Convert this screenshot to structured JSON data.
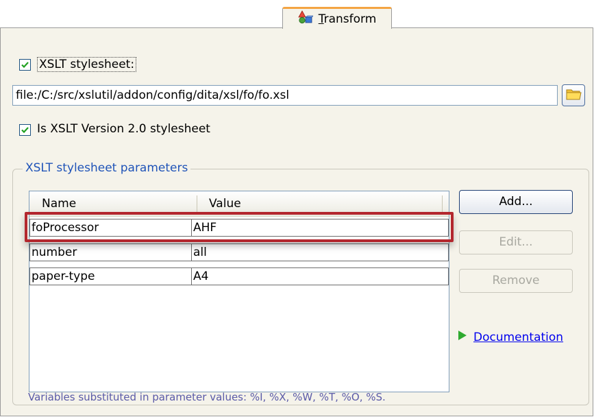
{
  "tab": {
    "label_mnemonic": "T",
    "label_rest": "ransform",
    "icon": "shapes-icon"
  },
  "xslt_stylesheet": {
    "label": "XSLT stylesheet:",
    "checked": true
  },
  "path_input": {
    "value": "file:/C:/src/xslutil/addon/config/dita/xsl/fo/fo.xsl"
  },
  "browse_button": {
    "icon": "folder-icon"
  },
  "xslt_version": {
    "label": "Is XSLT Version 2.0 stylesheet",
    "checked": true
  },
  "params_group": {
    "title": "XSLT stylesheet parameters"
  },
  "params_table": {
    "columns": [
      "Name",
      "Value"
    ],
    "rows": [
      {
        "name": "foProcessor",
        "value": "AHF"
      },
      {
        "name": "number",
        "value": "all"
      },
      {
        "name": "paper-type",
        "value": "A4"
      }
    ],
    "highlight_color": "#b3272e"
  },
  "buttons": {
    "add": "Add...",
    "edit": "Edit...",
    "remove": "Remove"
  },
  "documentation": {
    "label": "Documentation",
    "icon": "play-arrow-icon"
  },
  "vars_note": "Variables substituted in parameter values: %I, %X, %W, %T, %O, %S."
}
